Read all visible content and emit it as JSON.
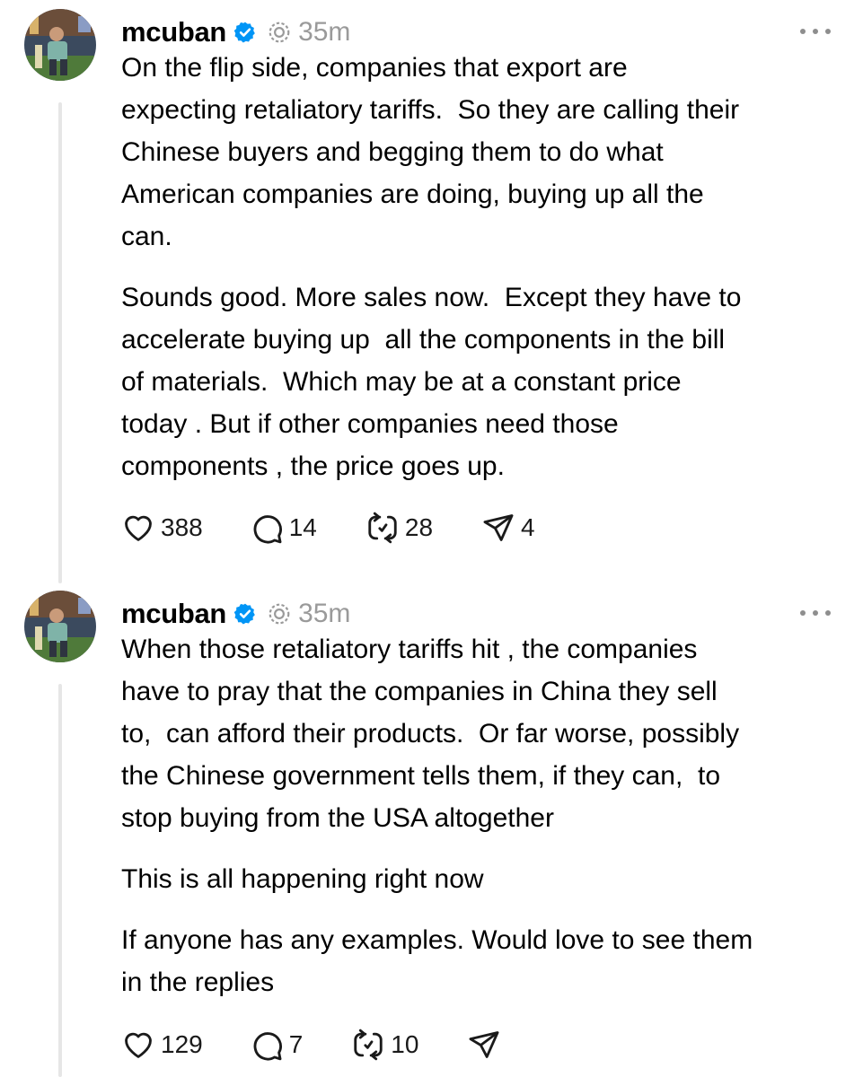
{
  "posts": [
    {
      "username": "mcuban",
      "timestamp": "35m",
      "paragraphs": [
        "On the flip side, companies that export are\nexpecting retaliatory tariffs.  So they are calling their\nChinese buyers and begging them to do what\nAmerican companies are doing, buying up all the\ncan.",
        "Sounds good. More sales now.  Except they have to\naccelerate buying up  all the components in the bill\nof materials.  Which may be at a constant price\ntoday . But if other companies need those\ncomponents , the price goes up."
      ],
      "likes": "388",
      "replies": "14",
      "reposts": "28",
      "shares": "4"
    },
    {
      "username": "mcuban",
      "timestamp": "35m",
      "paragraphs": [
        "When those retaliatory tariffs hit , the companies\nhave to pray that the companies in China they sell\nto,  can afford their products.  Or far worse, possibly\nthe Chinese government tells them, if they can,  to\nstop buying from the USA altogether",
        "This is all happening right now",
        "If anyone has any examples. Would love to see them\nin the replies"
      ],
      "likes": "129",
      "replies": "7",
      "reposts": "10",
      "shares": ""
    }
  ],
  "icons": {
    "verified": "verified-badge-icon",
    "thread": "threads-icon",
    "more": "more-icon",
    "like": "heart-icon",
    "reply": "comment-icon",
    "repost": "repost-icon",
    "share": "send-icon"
  },
  "colors": {
    "verified": "#0095f6",
    "muted": "#9a9a9a",
    "thread_line": "#e6e6e6",
    "text": "#000000"
  }
}
